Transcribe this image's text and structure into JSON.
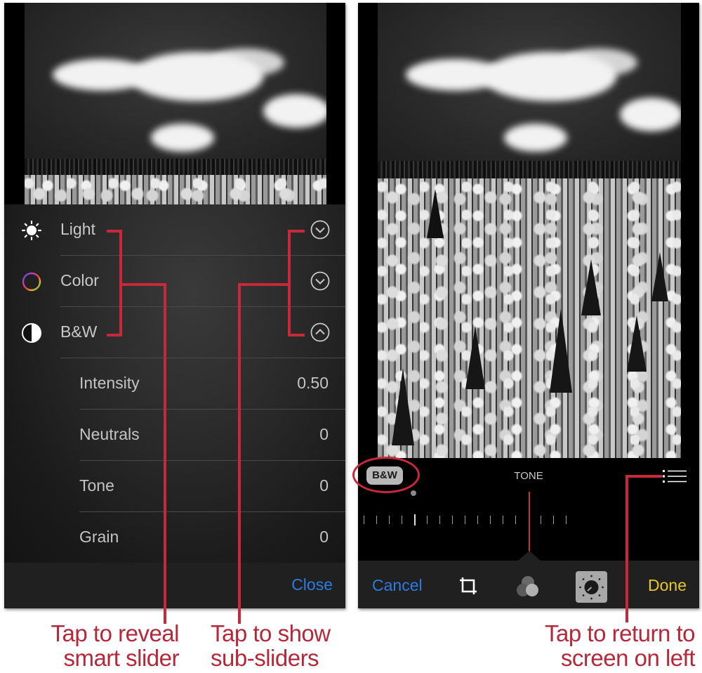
{
  "left_panel": {
    "adjustments": [
      {
        "label": "Light",
        "icon": "sun-icon",
        "chevron": "chevron-down"
      },
      {
        "label": "Color",
        "icon": "color-wheel-icon",
        "chevron": "chevron-down"
      },
      {
        "label": "B&W",
        "icon": "half-circle-icon",
        "chevron": "chevron-up"
      }
    ],
    "bw_sub_sliders": [
      {
        "label": "Intensity",
        "value": "0.50"
      },
      {
        "label": "Neutrals",
        "value": "0"
      },
      {
        "label": "Tone",
        "value": "0"
      },
      {
        "label": "Grain",
        "value": "0"
      }
    ],
    "close_label": "Close"
  },
  "right_panel": {
    "badge_label": "B&W",
    "slider_label": "TONE",
    "list_icon": "list-icon",
    "toolbar": {
      "cancel_label": "Cancel",
      "crop_icon": "crop-icon",
      "filters_icon": "filters-icon",
      "adjust_icon": "dial-icon",
      "done_label": "Done"
    }
  },
  "callouts": {
    "reveal_smart_slider": {
      "line1": "Tap to reveal",
      "line2": "smart slider"
    },
    "show_sub_sliders": {
      "line1": "Tap to show",
      "line2": "sub-sliders"
    },
    "return_to_left": {
      "line1": "Tap to return to",
      "line2": "screen on left"
    }
  },
  "colors": {
    "ios_blue": "#2e7be0",
    "ios_yellow": "#e8c826",
    "callout_red": "#c8283a"
  }
}
